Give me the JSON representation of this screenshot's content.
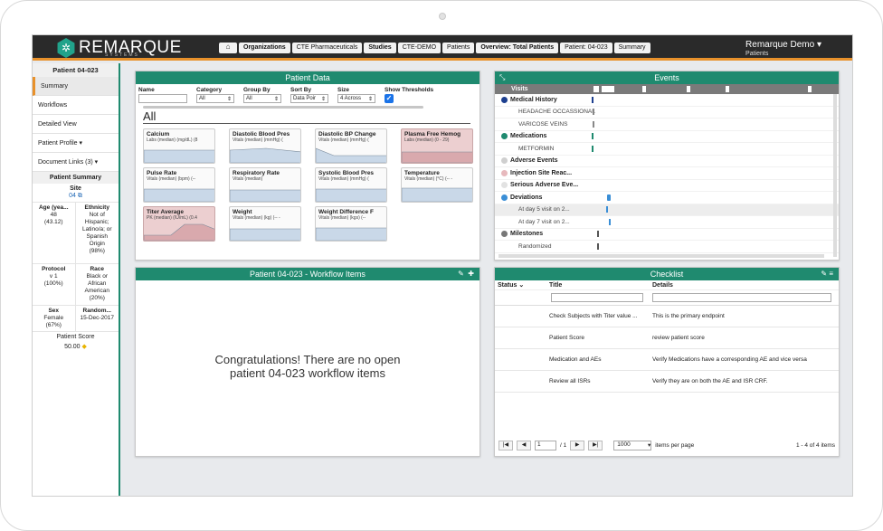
{
  "app": {
    "logo": "REMARQUE",
    "logo_sub": "SYSTEMS",
    "user": "Remarque Demo",
    "user_sub": "Patients"
  },
  "breadcrumbs": [
    "Organizations",
    "CTE Pharmaceuticals",
    "Studies",
    "CTE-DEMO",
    "Patients",
    "Overview: Total Patients",
    "Patient: 04-023",
    "Summary"
  ],
  "sidebar": {
    "title": "Patient 04-023",
    "items": [
      "Summary",
      "Workflows",
      "Detailed View",
      "Patient Profile",
      "Document Links (3)"
    ],
    "summary_title": "Patient Summary",
    "site_label": "Site",
    "site_value": "04",
    "age_label": "Age (yea...",
    "age_value": "48",
    "age_note": "(43.12)",
    "eth_label": "Ethnicity",
    "eth_value": "Not of Hispanic; Latino/a; or Spanish Origin",
    "eth_note": "(98%)",
    "protocol_label": "Protocol",
    "protocol_value": "v 1",
    "protocol_note": "(100%)",
    "race_label": "Race",
    "race_value": "Black or African American",
    "race_note": "(20%)",
    "sex_label": "Sex",
    "sex_value": "Female",
    "sex_note": "(67%)",
    "random_label": "Random...",
    "random_value": "15-Dec-2017",
    "score_label": "Patient Score",
    "score_value": "50.00"
  },
  "patient_data": {
    "title": "Patient Data",
    "name_label": "Name",
    "category_label": "Category",
    "category_value": "All",
    "groupby_label": "Group By",
    "groupby_value": "All",
    "sortby_label": "Sort By",
    "sortby_value": "Data Poir",
    "size_label": "Size",
    "size_value": "4 Across",
    "threshold_label": "Show Thresholds",
    "group_title": "All",
    "cards": [
      {
        "title": "Calcium",
        "sub": "Labs (median) (mg/dL) (8",
        "red": false
      },
      {
        "title": "Diastolic Blood Pres",
        "sub": "Vitals (median) (mmHg) (",
        "red": false
      },
      {
        "title": "Diastolic BP Change",
        "sub": "Vitals (median) (mmHg) (",
        "red": false
      },
      {
        "title": "Plasma Free Hemog",
        "sub": "Labs (median) (0 - 29)",
        "red": true
      },
      {
        "title": "Pulse Rate",
        "sub": "Vitals (median) (bpm) (--",
        "red": false
      },
      {
        "title": "Respiratory Rate",
        "sub": "Vitals (median)",
        "red": false
      },
      {
        "title": "Systolic Blood Pres",
        "sub": "Vitals (median) (mmHg) (",
        "red": false
      },
      {
        "title": "Temperature",
        "sub": "Vitals (median) (°C) (-- -",
        "red": false
      },
      {
        "title": "Titer Average",
        "sub": "PK (median) (IU/mL) (0.4",
        "red": true
      },
      {
        "title": "Weight",
        "sub": "Vitals (median) (kg) (-- -",
        "red": false
      },
      {
        "title": "Weight Difference F",
        "sub": "Vitals (median) (kgs) (--",
        "red": false
      }
    ]
  },
  "workflow": {
    "title": "Patient 04-023 - Workflow Items",
    "message": "Congratulations! There are no open patient 04-023 workflow items"
  },
  "events": {
    "title": "Events",
    "visits_label": "Visits",
    "rows": [
      {
        "label": "Medical History",
        "type": "grp",
        "color": "#1d3f8f"
      },
      {
        "label": "HEADACHE OCCASSIONAL",
        "type": "sub"
      },
      {
        "label": "VARICOSE VEINS",
        "type": "sub"
      },
      {
        "label": "Medications",
        "type": "grp",
        "color": "#1f8a6f"
      },
      {
        "label": "METFORMIN",
        "type": "sub"
      },
      {
        "label": "Adverse Events",
        "type": "grp",
        "color": "#cfcfcf"
      },
      {
        "label": "Injection Site Reac...",
        "type": "grp",
        "color": "#e7b9bd"
      },
      {
        "label": "Serious Adverse Eve...",
        "type": "grp",
        "color": "#e2e2e2"
      },
      {
        "label": "Deviations",
        "type": "grp",
        "color": "#3a8ed6"
      },
      {
        "label": "At day 5 visit on 2...",
        "type": "sub"
      },
      {
        "label": "At day 7 visit on 2...",
        "type": "sub"
      },
      {
        "label": "Milestones",
        "type": "grp",
        "color": "#777777"
      },
      {
        "label": "Randomized",
        "type": "sub"
      }
    ]
  },
  "checklist": {
    "title": "Checklist",
    "col_status": "Status",
    "col_title": "Title",
    "col_details": "Details",
    "rows": [
      {
        "title": "Check Subjects with Titer value ...",
        "details": "This is the primary endpoint"
      },
      {
        "title": "Patient Score",
        "details": "review patient score"
      },
      {
        "title": "Medication and AEs",
        "details": "Verify Medications have a corresponding AE and vice versa"
      },
      {
        "title": "Review all ISRs",
        "details": "Verify they are on both the AE and ISR CRF."
      }
    ],
    "page_value": "1",
    "page_of": "/ 1",
    "per_page": "1000",
    "per_page_label": "items per page",
    "count": "1 - 4 of 4 items"
  }
}
